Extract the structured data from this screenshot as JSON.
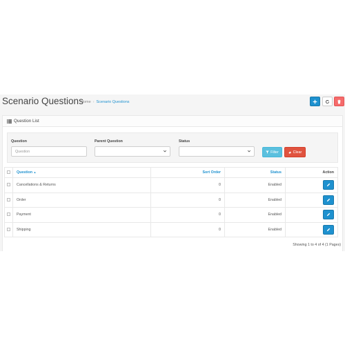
{
  "header": {
    "title": "Scenario Questions",
    "breadcrumb": {
      "home": "Home",
      "separator": "›",
      "current": "Scenario Questions"
    },
    "buttons": {
      "add_icon": "plus-icon",
      "refresh_icon": "refresh-icon",
      "delete_icon": "trash-icon"
    }
  },
  "panel": {
    "title": "Question List",
    "icon": "list-icon"
  },
  "filter": {
    "question_label": "Question",
    "question_placeholder": "Question",
    "parent_label": "Parent Question",
    "parent_value": "",
    "status_label": "Status",
    "status_value": "",
    "filter_button": "Filter",
    "clear_button": "Clear"
  },
  "table": {
    "columns": {
      "question": "Question",
      "sort_order": "Sort Order",
      "status": "Status",
      "action": "Action"
    },
    "sort_indicator": "▲",
    "rows": [
      {
        "question": "Cancellations & Returns",
        "sort_order": "0",
        "status": "Enabled"
      },
      {
        "question": "Order",
        "sort_order": "0",
        "status": "Enabled"
      },
      {
        "question": "Payment",
        "sort_order": "0",
        "status": "Enabled"
      },
      {
        "question": "Shipping",
        "sort_order": "0",
        "status": "Enabled"
      }
    ]
  },
  "pagination": {
    "info": "Showing 1 to 4 of 4 (1 Pages)"
  },
  "colors": {
    "primary": "#1e91cf",
    "danger": "#f56b6b",
    "info": "#5bc0de",
    "clear": "#e0533f"
  }
}
